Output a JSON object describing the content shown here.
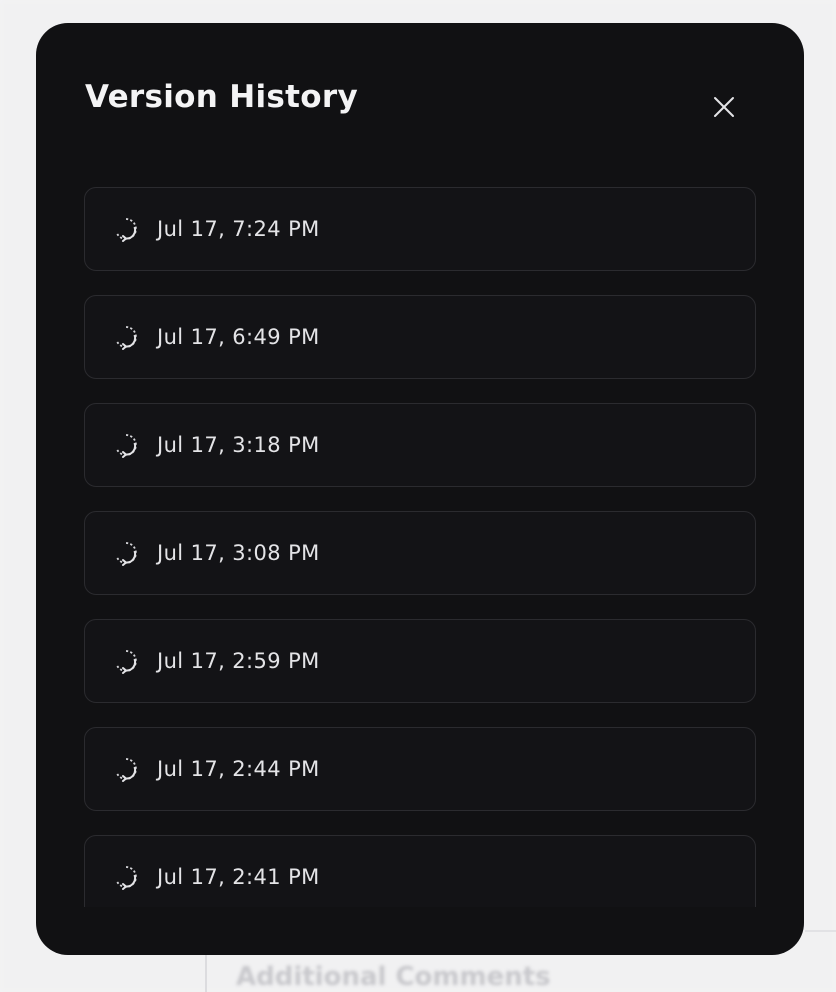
{
  "modal": {
    "title": "Version History",
    "close_icon": "close-icon"
  },
  "versions": [
    {
      "time": "Jul 17, 7:24 PM",
      "icon": "history-icon"
    },
    {
      "time": "Jul 17, 6:49 PM",
      "icon": "history-icon"
    },
    {
      "time": "Jul 17, 3:18 PM",
      "icon": "history-icon"
    },
    {
      "time": "Jul 17, 3:08 PM",
      "icon": "history-icon"
    },
    {
      "time": "Jul 17, 2:59 PM",
      "icon": "history-icon"
    },
    {
      "time": "Jul 17, 2:44 PM",
      "icon": "history-icon"
    },
    {
      "time": "Jul 17, 2:41 PM",
      "icon": "history-icon"
    }
  ],
  "background": {
    "comments_label": "Additional Comments"
  },
  "colors": {
    "modal_bg": "#111113",
    "item_border": "#2b2b2f",
    "text": "#e4e4e7"
  }
}
